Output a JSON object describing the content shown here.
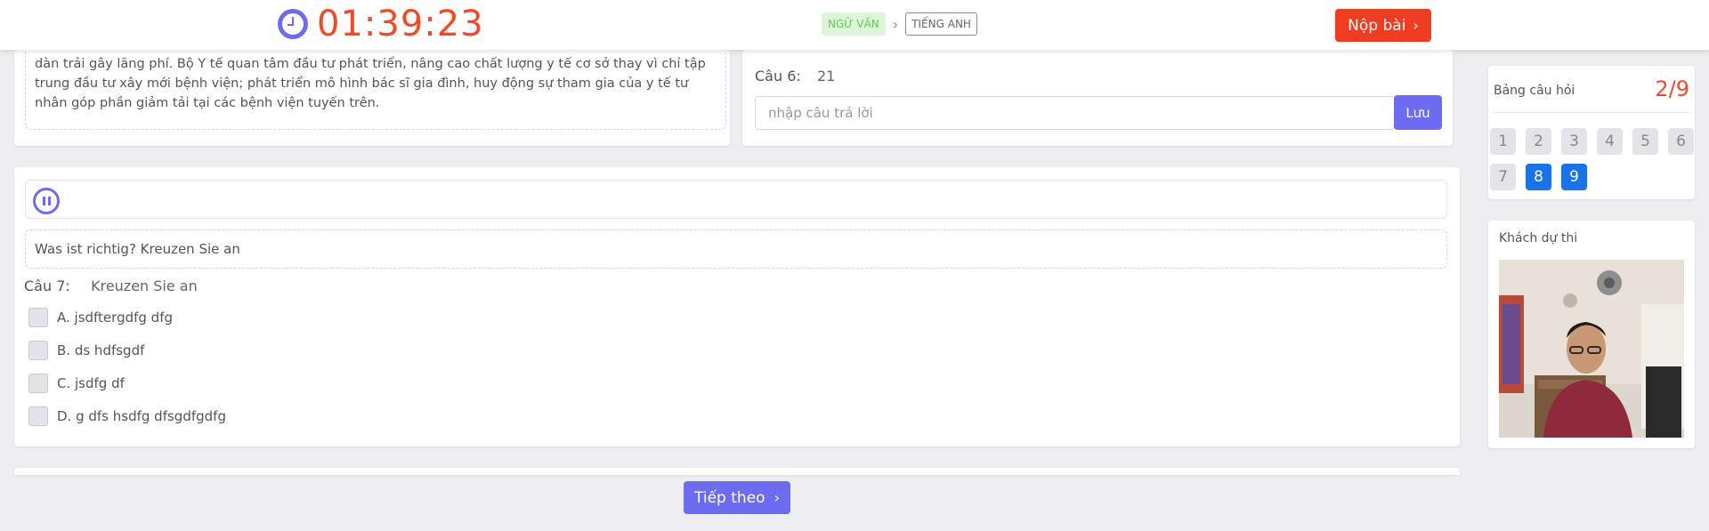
{
  "header": {
    "timer": "01:39:23",
    "subjects": {
      "active": "NGỮ VĂN",
      "next": "TIẾNG ANH"
    },
    "submit_label": "Nộp bài"
  },
  "passage": {
    "text": "dàn trải gây lãng phí. Bộ Y tế quan tâm đầu tư phát triển, nâng cao chất lượng y tế cơ sở thay vì chỉ tập trung đầu tư xây mới bệnh viện; phát triển mô hình bác sĩ gia đình, huy động sự tham gia của y tế tư nhân góp phần giảm tải tại các bệnh viện tuyến trên."
  },
  "question6": {
    "label": "Câu 6:",
    "value": "21",
    "placeholder": "nhập câu trả lời",
    "save_label": "Lưu"
  },
  "question7": {
    "instruction": "Was ist richtig? Kreuzen Sie an",
    "label": "Câu 7:",
    "prompt": "Kreuzen Sie an",
    "options": [
      "A.  jsdftergdfg dfg",
      "B.  ds hdfsgdf",
      "C.  jsdfg df",
      "D.  g dfs hsdfg dfsgdfgdfg"
    ]
  },
  "next_label": "Tiếp theo",
  "question_board": {
    "title": "Bảng câu hỏi",
    "count": "2/9",
    "numbers": [
      "1",
      "2",
      "3",
      "4",
      "5",
      "6",
      "7",
      "8",
      "9"
    ],
    "answered": [
      "8",
      "9"
    ]
  },
  "examinee": {
    "title": "Khách dự thi"
  },
  "colors": {
    "accent": "#6b6cf0",
    "danger": "#ef3d22",
    "answered": "#1a73e8"
  }
}
